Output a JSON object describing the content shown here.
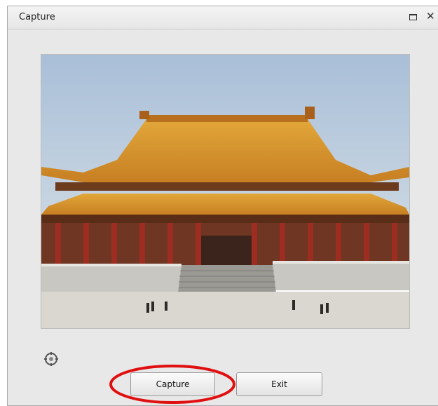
{
  "window": {
    "title": "Capture",
    "close_glyph": "✕"
  },
  "preview": {
    "description_icon": "camera-preview-image"
  },
  "icons": {
    "maximize": "maximize-icon",
    "close": "close-icon",
    "settings": "camera-settings-icon"
  },
  "buttons": {
    "capture_label": "Capture",
    "exit_label": "Exit"
  },
  "annotation": {
    "highlight_color": "#e01010"
  }
}
